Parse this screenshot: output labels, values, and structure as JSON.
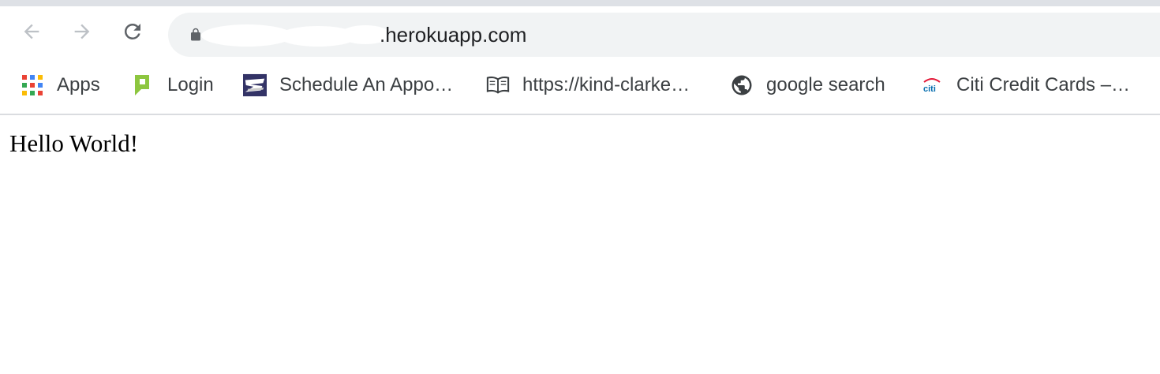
{
  "browser": {
    "nav": {
      "back": "arrow-left-icon",
      "forward": "arrow-right-icon",
      "reload": "reload-icon"
    },
    "address_bar": {
      "lock_icon": "lock-icon",
      "url_visible_suffix": ".herokuapp.com"
    }
  },
  "bookmarks": [
    {
      "label": "Apps",
      "icon": "apps-grid-icon"
    },
    {
      "label": "Login",
      "icon": "login-bookmark-icon"
    },
    {
      "label": "Schedule An Appo…",
      "icon": "usps-eagle-icon"
    },
    {
      "label": "https://kind-clarke…",
      "icon": "open-book-icon"
    },
    {
      "label": "google search",
      "icon": "globe-icon"
    },
    {
      "label": "Citi Credit Cards –…",
      "icon": "citi-logo-icon"
    }
  ],
  "page": {
    "text": "Hello World!"
  },
  "colors": {
    "toolbar_bg": "#ffffff",
    "omnibox_bg": "#f1f3f4",
    "tab_strip": "#dee1e6",
    "text_primary": "#202124",
    "bookmark_text": "#3c4043",
    "icon_gray": "#5f6368"
  }
}
